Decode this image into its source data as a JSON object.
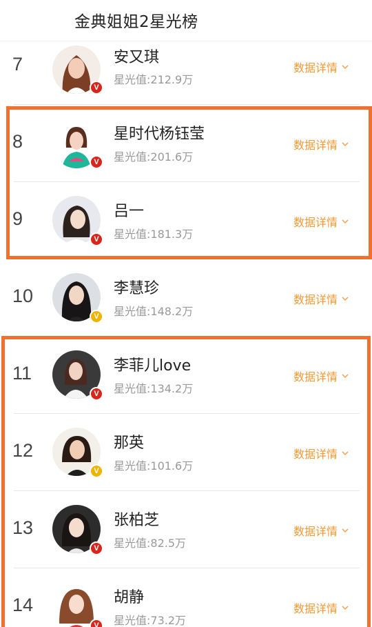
{
  "header": {
    "title": "金典姐姐2星光榜"
  },
  "detail_label": "数据详情",
  "colors": {
    "accent": "#f09a37",
    "highlight": "#f07030",
    "badge_red": "#d7261b",
    "badge_gold": "#f0b400"
  },
  "rows": [
    {
      "rank": "7",
      "name": "安又琪",
      "stat": "星光值:212.9万",
      "badge": "V",
      "badge_color": "red"
    },
    {
      "rank": "8",
      "name": "星时代杨钰莹",
      "stat": "星光值:201.6万",
      "badge": "V",
      "badge_color": "red"
    },
    {
      "rank": "9",
      "name": "吕一",
      "stat": "星光值:181.3万",
      "badge": "V",
      "badge_color": "red"
    },
    {
      "rank": "10",
      "name": "李慧珍",
      "stat": "星光值:148.2万",
      "badge": "V",
      "badge_color": "gold"
    },
    {
      "rank": "11",
      "name": "李菲儿love",
      "stat": "星光值:134.2万",
      "badge": "V",
      "badge_color": "red"
    },
    {
      "rank": "12",
      "name": "那英",
      "stat": "星光值:101.6万",
      "badge": "V",
      "badge_color": "gold"
    },
    {
      "rank": "13",
      "name": "张柏芝",
      "stat": "星光值:82.5万",
      "badge": "V",
      "badge_color": "red"
    },
    {
      "rank": "14",
      "name": "胡静",
      "stat": "星光值:73.2万",
      "badge": "V",
      "badge_color": "red"
    }
  ]
}
